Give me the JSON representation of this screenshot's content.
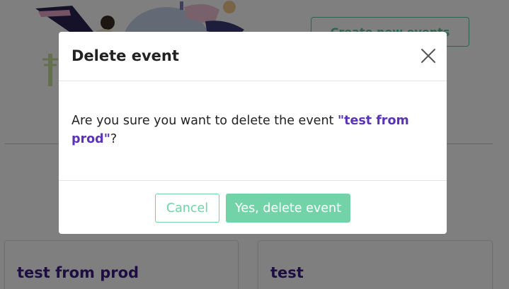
{
  "background": {
    "create_button_label": "Create new events",
    "events": [
      {
        "title": "test from prod"
      },
      {
        "title": "test"
      }
    ]
  },
  "modal": {
    "title": "Delete event",
    "message_prefix": "Are you sure you want to delete the event ",
    "event_name": "\"test from prod\"",
    "message_suffix": "?",
    "cancel_label": "Cancel",
    "confirm_label": "Yes, delete event",
    "close_icon": "close-icon"
  },
  "colors": {
    "accent_green": "#73d3a8",
    "event_title": "#3a1a86",
    "event_name_highlight": "#5a33b8"
  }
}
